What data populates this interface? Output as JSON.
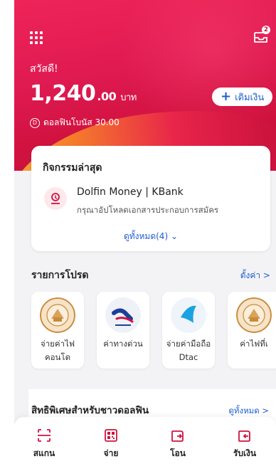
{
  "header": {
    "greeting": "สวัสดี!",
    "balance_main": "1,240",
    "balance_decimal": ".00",
    "currency": "บาท",
    "bonus_label": "ดอลฟินโบนัส 30.00",
    "topup_label": "เติมเงิน",
    "notification_count": "2"
  },
  "activity": {
    "title": "กิจกรรมล่าสุด",
    "item_name": "Dolfin Money | KBank",
    "item_description": "กรุณาอัปโหลดเอกสารประกอบการสมัคร",
    "see_all": "ดูทั้งหมด(4)"
  },
  "favorites": {
    "title": "รายการโปรด",
    "settings": "ตั้งค่า >",
    "items": [
      {
        "label": "จ่ายค่าไฟ คอนโด",
        "icon": "government-seal-icon"
      },
      {
        "label": "ค่าทางด่วน",
        "icon": "expressway-icon"
      },
      {
        "label": "จ่ายค่ามือถือ Dtac",
        "icon": "dtac-logo-icon"
      },
      {
        "label": "ค่าไฟที่เ",
        "icon": "government-seal-icon"
      }
    ]
  },
  "privileges": {
    "title": "สิทธิพิเศษสำหรับชาวดอลฟิน",
    "see_all": "ดูทั้งหมด >"
  },
  "bottom_nav": [
    {
      "label": "สแกน",
      "icon": "scan-icon"
    },
    {
      "label": "จ่าย",
      "icon": "qr-pay-icon"
    },
    {
      "label": "โอน",
      "icon": "transfer-icon"
    },
    {
      "label": "รับเงิน",
      "icon": "receive-icon"
    }
  ],
  "colors": {
    "brand_red": "#e01a52",
    "link_blue": "#1e5fcf",
    "background": "#f3f3f5"
  }
}
